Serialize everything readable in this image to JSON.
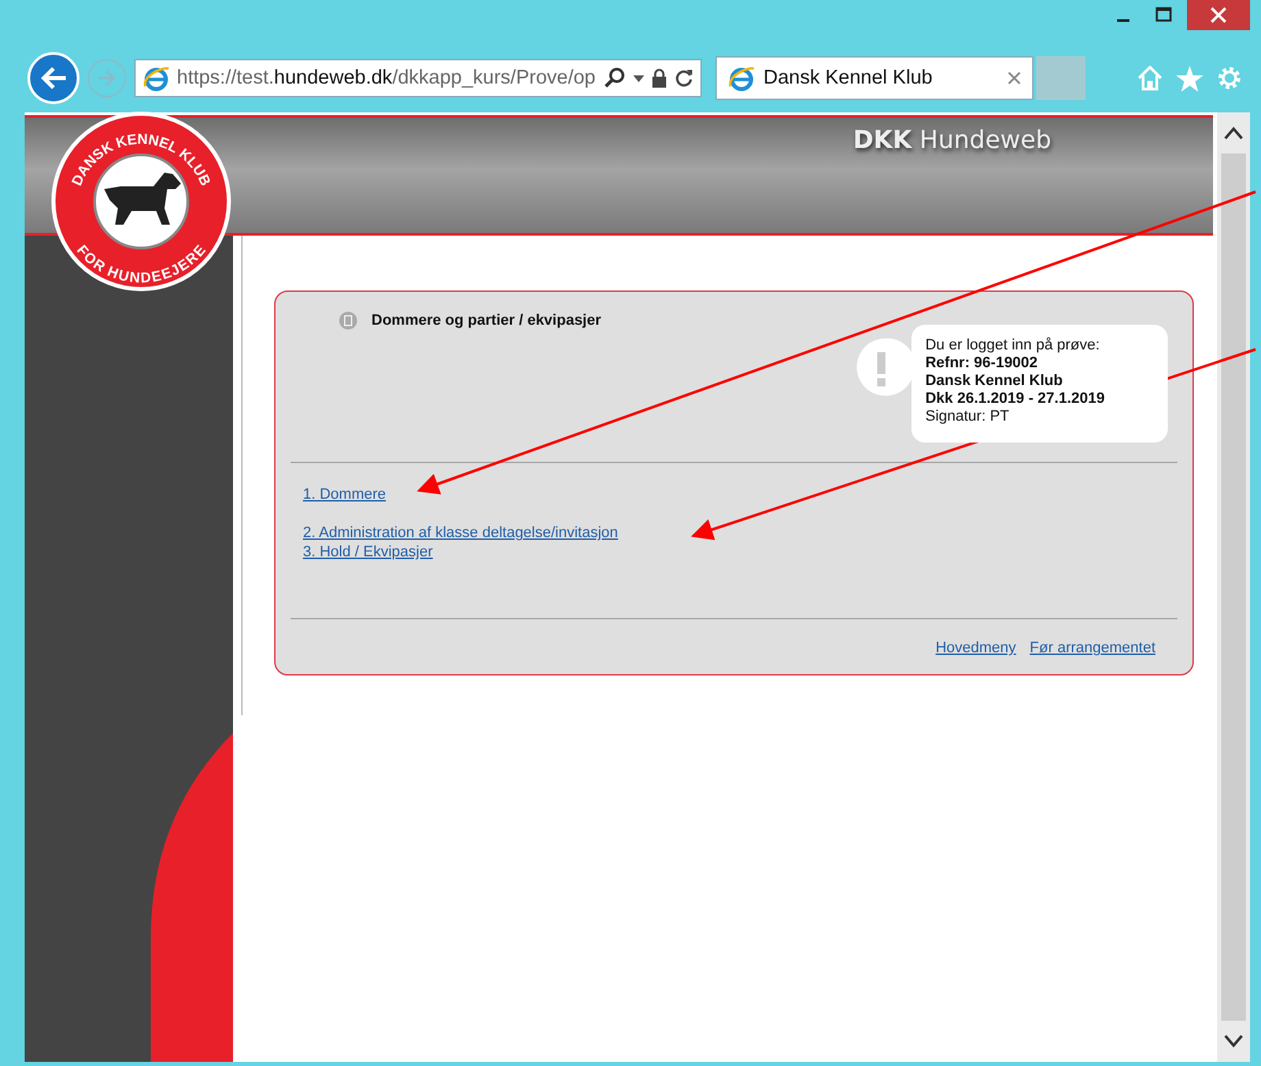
{
  "browser": {
    "address": "https://test.**hundeweb.dk**/dkkapp_kurs/Prove/op",
    "tab": {
      "title": "Dansk Kennel Klub",
      "selected": true
    }
  },
  "header": {
    "title": "**DKK** Hundeweb"
  },
  "logo": {
    "top_text": "DANSK KENNEL KLUB",
    "bottom_text": "FOR HUNDEEJERE"
  },
  "panel": {
    "title": "Dommere og partier / ekvipasjer",
    "info": [
      {
        "text": "Du er logget inn på prøve:",
        "kind": "label"
      },
      {
        "text": "Refnr: 96-19002",
        "kind": "value"
      },
      {
        "text": "Dansk Kennel Klub",
        "kind": "value"
      },
      {
        "text": "Dkk 26.1.2019 - 27.1.2019",
        "kind": "value"
      },
      {
        "text": "Signatur: PT",
        "kind": "label"
      }
    ],
    "link_groups": [
      [
        "1. Dommere"
      ],
      [
        "2. Administration af klasse deltagelse/invitasjon",
        "3. Hold / Ekvipasjer"
      ]
    ],
    "footer_links": [
      "Hovedmeny",
      "Før arrangementet"
    ]
  }
}
